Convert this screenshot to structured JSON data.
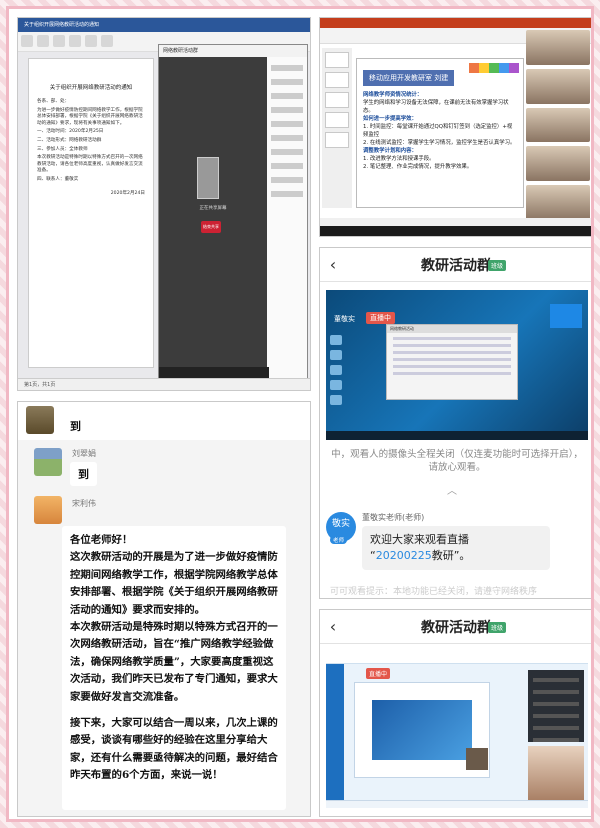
{
  "panel1": {
    "word_title": "关于组织开展网络教研活动的通知",
    "doc_title": "关于组织开展网络教研活动的通知",
    "doc_lines": [
      "各系、部、处：",
      "为进一步做好疫情防控期间网络教学工作，根据学院总体安排部署，根据学院《关于组织开展网络教研活动的通知》要求，现将有关事项通知如下。",
      "一、活动时间：2020年2月25日",
      "二、活动形式：网络教研活动群",
      "三、参加人员：全体教师",
      "本次教研活动是特殊时期以特殊方式召开的一次网络教研活动，请各位老师高度重视，认真做好发言交流准备。",
      "四、联系人：董敬实"
    ],
    "doc_sign": "2020年2月24日",
    "word_status": "第1页，共1页",
    "chat_title": "网络教研活动群",
    "chat_caption": "正在共享屏幕",
    "hangup_label": "结束共享"
  },
  "panel2": {
    "slide_title": "移动应用开发教研室 刘建",
    "slide_lines": [
      {
        "text": "网络教学师资情况统计：",
        "head": true
      },
      {
        "text": "学生的网络和学习设备无法保障，在课前无法有效掌握学习状态。",
        "head": false
      },
      {
        "text": "如何进一步提高学效：",
        "head": true
      },
      {
        "text": "1. 时间监控：每堂课开始通过QQ和钉钉签到（选定监控）+视频监控",
        "head": false
      },
      {
        "text": "2. 在线测试监控：掌握学生学习情况，监控学生是否认真学习。",
        "head": false
      },
      {
        "text": "调整教学计划和内容：",
        "head": true
      },
      {
        "text": "1. 改进教学方法和授课手段。",
        "head": false
      },
      {
        "text": "2. 笔记整理、作业完成情况，提升教学效果。",
        "head": false
      }
    ]
  },
  "panel3": {
    "back_icon": "‹",
    "title": "教研活动群",
    "badge": "班级",
    "live_host": "董敬实",
    "live_tag": "直播中",
    "live_window_title": "网络教研活动",
    "sys_msg": "中，观看人的摄像头全程关闭（仅连麦功能时可选择开启），请放心观看。",
    "collapse_icon": "︿",
    "avatar_text": "敬实",
    "avatar_tag": "老师",
    "sender": "董敬实老师(老师)",
    "bubble_prefix": "欢迎大家来观看直播",
    "bubble_quote_open": "“",
    "bubble_highlight": "20200225",
    "bubble_suffix": "教研”。",
    "faded_text": "可可观看提示：本地功能已经关闭，请遵守网络秩序"
  },
  "panel4": {
    "back_icon": "‹",
    "title": "教研活动群",
    "badge": "班级",
    "live_tag": "直播中"
  },
  "panel5": {
    "msg0_text": "到",
    "msg1_name": "刘翠娟",
    "msg1_text": "到",
    "msg2_name": "宋利伟",
    "notice_paragraphs": [
      "各位老师好！",
      "这次教研活动的开展是为了进一步做好疫情防控期间网络教学工作，根据学院网络教学总体安排部署、根据学院《关于组织开展网络教研活动的通知》要求而安排的。",
      "本次教研活动是特殊时期以特殊方式召开的一次网络教研活动，旨在“推广网络教学经验做法，确保网络教学质量”，大家要高度重视这次活动，我们昨天已发布了专门通知，要求大家要做好发言交流准备。"
    ],
    "notice_paragraph_2": "接下来，大家可以结合一周以来，几次上课的感受，谈谈有哪些好的经验在这里分享给大家，还有什么需要亟待解决的问题，最好结合昨天布置的6个方面，来说一说！"
  }
}
